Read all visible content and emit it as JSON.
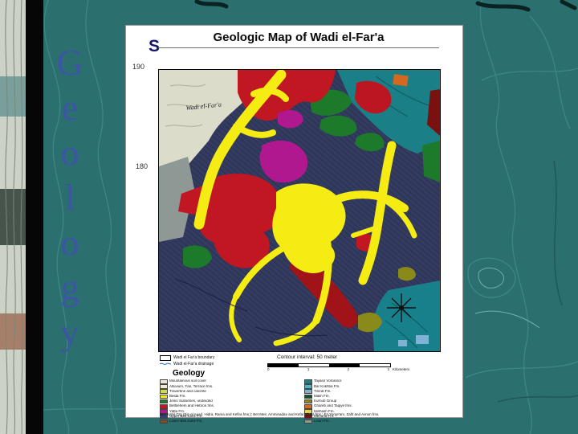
{
  "slide": {
    "vertical_title_letters": [
      "G",
      "e",
      "o",
      "l",
      "o",
      "g",
      "y"
    ],
    "partial_heading": "S"
  },
  "map_figure": {
    "title": "Geologic Map of Wadi el-Far'a",
    "grid_labels": {
      "top": "190",
      "middle": "180"
    },
    "map_label": "Wadi el-Far'a",
    "footer": {
      "boundary_label": "Wadi el Far'a boundary",
      "drainage_label": "Wadi el-Far'a drainage",
      "contour_note": "Contour interval: 50 meter",
      "scale": {
        "ticks": [
          "0",
          "1",
          "2",
          "3"
        ],
        "unit": "Kilometers"
      },
      "geology_heading": "Geology",
      "legend_left": [
        {
          "color": "#e8e6d8",
          "label": "Mountainous soil cover"
        },
        {
          "color": "#f0ead0",
          "label": "Alluvium, Fan, Terrace fms."
        },
        {
          "color": "#cddc4a",
          "label": "Travertine and calcrete"
        },
        {
          "color": "#f4ec12",
          "label": "Beida Fm."
        },
        {
          "color": "#1d7a2a",
          "label": "Jenin Subseries, undivided"
        },
        {
          "color": "#c01722",
          "label": "Bethlehem and Hebron fms."
        },
        {
          "color": "#b0188f",
          "label": "Yatta Fm."
        },
        {
          "color": "#32407c",
          "label": "Upper Beit Kahil Fm."
        },
        {
          "color": "#7a4a2a",
          "label": "Lower Beit Kahil Fm."
        }
      ],
      "legend_right": [
        {
          "color": "#1a7f86",
          "label": "Tayasir Volcanics"
        },
        {
          "color": "#49b8c0",
          "label": "Bar Kokhba Fm."
        },
        {
          "color": "#7fb3d5",
          "label": "Timrat Fm."
        },
        {
          "color": "#14502a",
          "label": "Malih Fm."
        },
        {
          "color": "#8a8a1a",
          "label": "Kurnub Group"
        },
        {
          "color": "#d2691e",
          "label": "Ghareb and Taqiye fms."
        },
        {
          "color": "#e8d44a",
          "label": "Mishash Fm."
        },
        {
          "color": "#7a1010",
          "label": "Menuha Fm."
        },
        {
          "color": "#8e9894",
          "label": "Lisan Fm."
        }
      ],
      "caption": "Beit Kahil Grp (Ein el Asad, Hidra, Rama and Kefira fms.); Bet Meir, Amminadav and Kefar Shaul fms.; En Yorqe'am, Zafit and Avnon fms."
    }
  },
  "colors": {
    "background_teal": "#2b6f6f",
    "contour_line": "#3f8a8a",
    "letter_blue": "#3c55a5",
    "map_palette": {
      "background_hatch": "#343b60",
      "yellow": "#f4ec12",
      "red": "#c01722",
      "dark_red": "#a01318",
      "magenta": "#b0188f",
      "green": "#1d7a2a",
      "teal": "#17808a",
      "gray": "#8e9894",
      "pale": "#dcdccb",
      "orange": "#d2691e",
      "olive": "#8a8a1a",
      "light_blue": "#7fb3d5"
    }
  }
}
